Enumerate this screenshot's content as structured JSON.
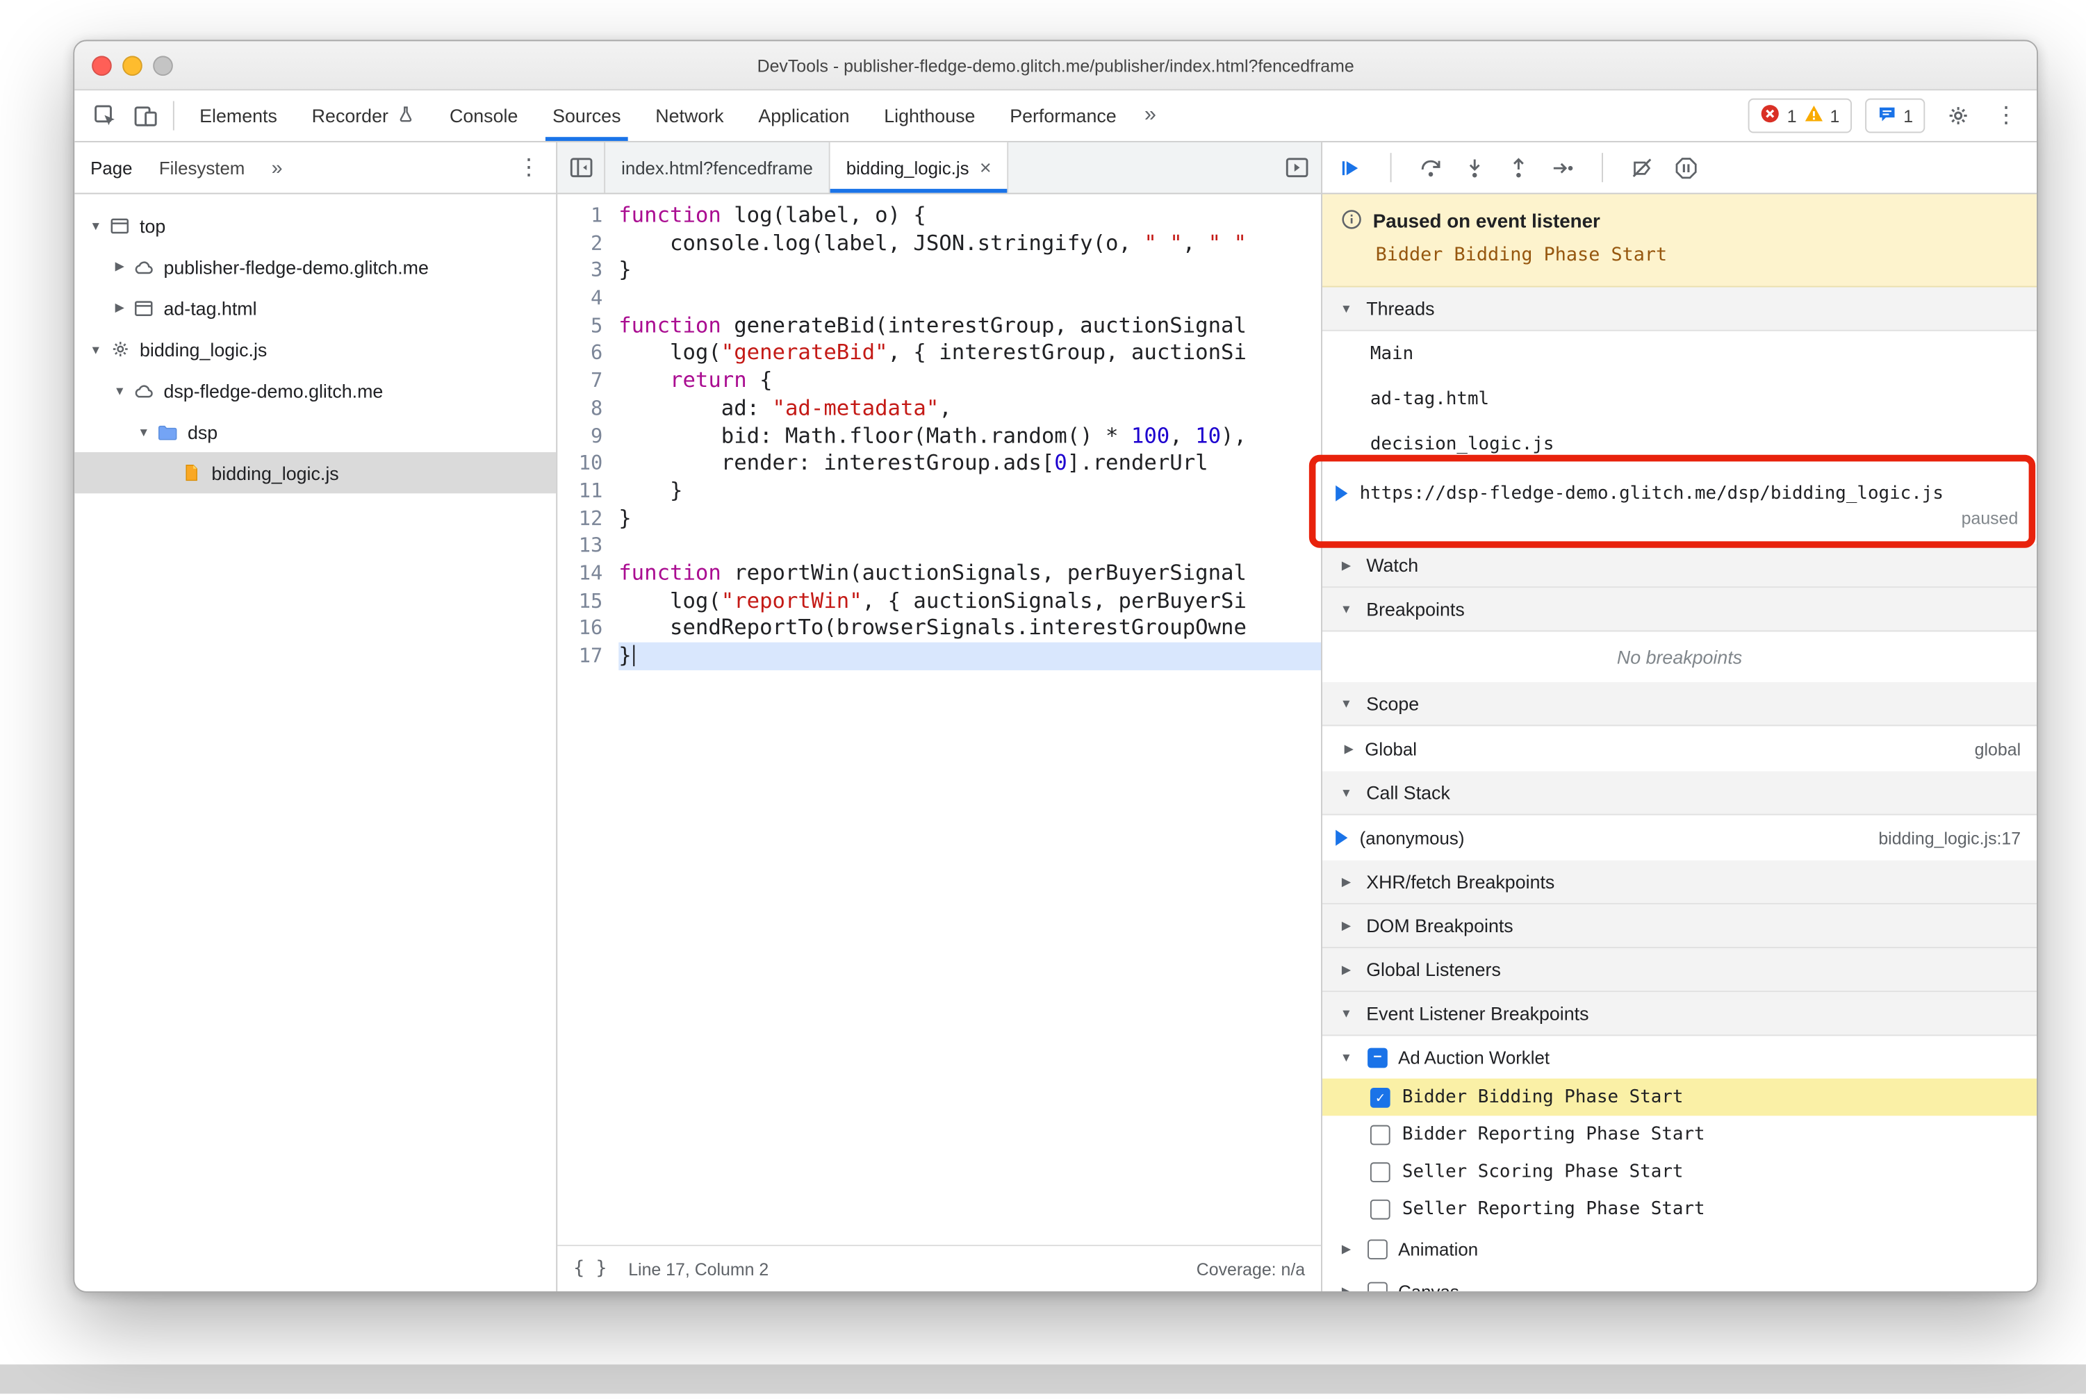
{
  "colors": {
    "accent": "#1a73e8",
    "annotation": "#e8220c",
    "exec_line": "#d9e7fd",
    "selection_row": "#dadada",
    "highlight_row": "#faf0a6",
    "banner_bg": "#fdf3cd",
    "keyword": "#aa0d91",
    "string": "#c41a16",
    "number": "#1c00cf",
    "error": "#d93025",
    "warning": "#f9ab00",
    "traffic": [
      "#ff5f57",
      "#febc2e",
      "#c4c4c4"
    ]
  },
  "icons": {
    "expand_down": "▼",
    "expand_right": "▶",
    "check": "✓",
    "minus": "−"
  },
  "window": {
    "title": "DevTools - publisher-fledge-demo.glitch.me/publisher/index.html?fencedframe"
  },
  "toolbar": {
    "tabs": [
      {
        "label": "Elements"
      },
      {
        "label": "Recorder",
        "icon": "flask-icon"
      },
      {
        "label": "Console"
      },
      {
        "label": "Sources",
        "active": true
      },
      {
        "label": "Network"
      },
      {
        "label": "Application"
      },
      {
        "label": "Lighthouse"
      },
      {
        "label": "Performance"
      }
    ],
    "more_label": "»",
    "menu_label": "⋮",
    "error_count": "1",
    "warning_count": "1",
    "issues_count": "1"
  },
  "navigator": {
    "tabs": [
      {
        "label": "Page",
        "active": true
      },
      {
        "label": "Filesystem",
        "active": false
      }
    ],
    "more_label": "»",
    "menu_label": "⋮",
    "tree": [
      {
        "indent": 0,
        "expander": "down",
        "icon": "frame-icon",
        "label": "top"
      },
      {
        "indent": 1,
        "expander": "right",
        "icon": "cloud-icon",
        "label": "publisher-fledge-demo.glitch.me"
      },
      {
        "indent": 1,
        "expander": "right",
        "icon": "frame-icon",
        "label": "ad-tag.html"
      },
      {
        "indent": 0,
        "expander": "down",
        "icon": "gear-icon",
        "label": "bidding_logic.js"
      },
      {
        "indent": 1,
        "expander": "down",
        "icon": "cloud-icon",
        "label": "dsp-fledge-demo.glitch.me"
      },
      {
        "indent": 2,
        "expander": "down",
        "icon": "folder-icon",
        "label": "dsp"
      },
      {
        "indent": 3,
        "expander": null,
        "icon": "js-file-icon",
        "label": "bidding_logic.js",
        "selected": true
      }
    ]
  },
  "editor": {
    "tabs": [
      {
        "label": "index.html?fencedframe",
        "active": false,
        "closable": false
      },
      {
        "label": "bidding_logic.js",
        "active": true,
        "closable": true
      }
    ],
    "lines": [
      {
        "n": "1",
        "tokens": [
          [
            "kw",
            "function"
          ],
          [
            "pl",
            " log(label, o) {"
          ]
        ]
      },
      {
        "n": "2",
        "tokens": [
          [
            "pl",
            "    console.log(label, JSON.stringify(o, "
          ],
          [
            "str",
            "\" \""
          ],
          [
            "pl",
            ", "
          ],
          [
            "str",
            "\" \""
          ]
        ]
      },
      {
        "n": "3",
        "tokens": [
          [
            "pl",
            "}"
          ]
        ]
      },
      {
        "n": "4",
        "tokens": []
      },
      {
        "n": "5",
        "tokens": [
          [
            "kw",
            "function"
          ],
          [
            "pl",
            " generateBid(interestGroup, auctionSignal"
          ]
        ]
      },
      {
        "n": "6",
        "tokens": [
          [
            "pl",
            "    log("
          ],
          [
            "str",
            "\"generateBid\""
          ],
          [
            "pl",
            ", { interestGroup, auctionSi"
          ]
        ]
      },
      {
        "n": "7",
        "tokens": [
          [
            "pl",
            "    "
          ],
          [
            "kw",
            "return"
          ],
          [
            "pl",
            " {"
          ]
        ]
      },
      {
        "n": "8",
        "tokens": [
          [
            "pl",
            "        ad: "
          ],
          [
            "str",
            "\"ad-metadata\""
          ],
          [
            "pl",
            ","
          ]
        ]
      },
      {
        "n": "9",
        "tokens": [
          [
            "pl",
            "        bid: Math.floor(Math.random() * "
          ],
          [
            "num",
            "100"
          ],
          [
            "pl",
            ", "
          ],
          [
            "num",
            "10"
          ],
          [
            "pl",
            "),"
          ]
        ]
      },
      {
        "n": "10",
        "tokens": [
          [
            "pl",
            "        render: interestGroup.ads["
          ],
          [
            "num",
            "0"
          ],
          [
            "pl",
            "].renderUrl"
          ]
        ]
      },
      {
        "n": "11",
        "tokens": [
          [
            "pl",
            "    }"
          ]
        ]
      },
      {
        "n": "12",
        "tokens": [
          [
            "pl",
            "}"
          ]
        ]
      },
      {
        "n": "13",
        "tokens": []
      },
      {
        "n": "14",
        "tokens": [
          [
            "kw",
            "function"
          ],
          [
            "pl",
            " reportWin(auctionSignals, perBuyerSignal"
          ]
        ]
      },
      {
        "n": "15",
        "tokens": [
          [
            "pl",
            "    log("
          ],
          [
            "str",
            "\"reportWin\""
          ],
          [
            "pl",
            ", { auctionSignals, perBuyerSi"
          ]
        ]
      },
      {
        "n": "16",
        "tokens": [
          [
            "pl",
            "    sendReportTo(browserSignals.interestGroupOwne"
          ]
        ]
      },
      {
        "n": "17",
        "tokens": [
          [
            "pl",
            "}"
          ]
        ],
        "current": true
      }
    ],
    "status": {
      "line_col": "Line 17, Column 2",
      "coverage": "Coverage: n/a"
    }
  },
  "debugger": {
    "paused_banner": {
      "title": "Paused on event listener",
      "detail": "Bidder Bidding Phase Start"
    },
    "rows": [
      {
        "type": "header",
        "label": "Threads",
        "expanded": true
      },
      {
        "type": "thread",
        "label": "Main"
      },
      {
        "type": "thread",
        "label": "ad-tag.html"
      },
      {
        "type": "thread",
        "label": "decision_logic.js"
      },
      {
        "type": "thread_active",
        "label": "https://dsp-fledge-demo.glitch.me/dsp/bidding_logic.js",
        "status": "paused"
      },
      {
        "type": "header",
        "label": "Watch",
        "expanded": false
      },
      {
        "type": "header",
        "label": "Breakpoints",
        "expanded": true
      },
      {
        "type": "empty",
        "label": "No breakpoints"
      },
      {
        "type": "header",
        "label": "Scope",
        "expanded": true
      },
      {
        "type": "scope",
        "label": "Global",
        "right": "global"
      },
      {
        "type": "header",
        "label": "Call Stack",
        "expanded": true
      },
      {
        "type": "frame",
        "label": "(anonymous)",
        "right": "bidding_logic.js:17"
      },
      {
        "type": "header",
        "label": "XHR/fetch Breakpoints",
        "expanded": false
      },
      {
        "type": "header",
        "label": "DOM Breakpoints",
        "expanded": false
      },
      {
        "type": "header",
        "label": "Global Listeners",
        "expanded": false
      },
      {
        "type": "header",
        "label": "Event Listener Breakpoints",
        "expanded": true
      },
      {
        "type": "elb_group",
        "label": "Ad Auction Worklet",
        "expanded": true,
        "check": "indeterminate"
      },
      {
        "type": "elb_item",
        "label": "Bidder Bidding Phase Start",
        "checked": true,
        "highlighted": true
      },
      {
        "type": "elb_item",
        "label": "Bidder Reporting Phase Start",
        "checked": false
      },
      {
        "type": "elb_item",
        "label": "Seller Scoring Phase Start",
        "checked": false
      },
      {
        "type": "elb_item",
        "label": "Seller Reporting Phase Start",
        "checked": false
      },
      {
        "type": "elb_group",
        "label": "Animation",
        "expanded": false,
        "check": "unchecked"
      },
      {
        "type": "elb_group",
        "label": "Canvas",
        "expanded": false,
        "check": "unchecked"
      }
    ]
  }
}
